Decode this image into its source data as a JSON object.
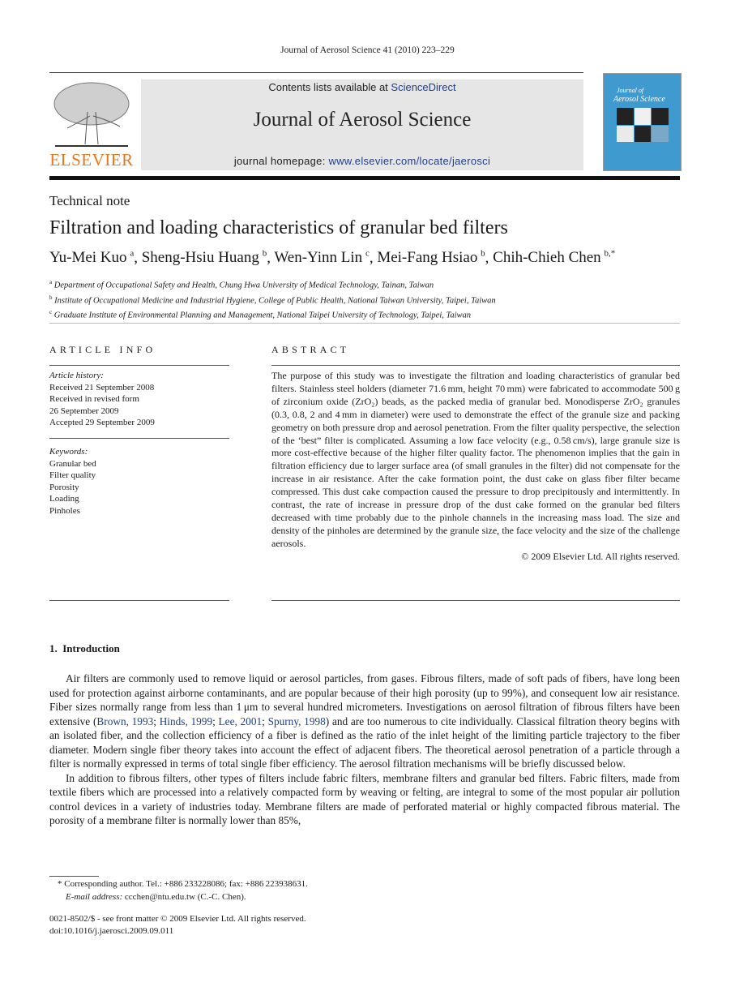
{
  "running_head": "Journal of Aerosol Science 41 (2010) 223–229",
  "publisher_logo": {
    "word": "ELSEVIER",
    "color": "#e8771a"
  },
  "banner": {
    "contents_prefix": "Contents lists available at ",
    "contents_link": "ScienceDirect",
    "journal_title": "Journal of Aerosol Science",
    "homepage_prefix": "journal homepage: ",
    "homepage_link": "www.elsevier.com/locate/jaerosci",
    "background": "#e6e6e6",
    "link_color": "#1f3e8c"
  },
  "cover": {
    "line1": "Journal of",
    "line2": "Aerosol Science",
    "color": "#3f9ad0"
  },
  "article_type": "Technical note",
  "title": "Filtration and loading characteristics of granular bed filters",
  "authors": [
    {
      "name": "Yu-Mei Kuo",
      "sup": "a",
      "sep": ", "
    },
    {
      "name": "Sheng-Hsiu Huang",
      "sup": "b",
      "sep": ", "
    },
    {
      "name": "Wen-Yinn Lin",
      "sup": "c",
      "sep": ", "
    },
    {
      "name": "Mei-Fang Hsiao",
      "sup": "b",
      "sep": ", "
    },
    {
      "name": "Chih-Chieh Chen",
      "sup": "b,*",
      "sep": ""
    }
  ],
  "affiliations": [
    {
      "sup": "a",
      "text": "Department of Occupational Safety and Health, Chung Hwa University of Medical Technology, Tainan, Taiwan"
    },
    {
      "sup": "b",
      "text": "Institute of Occupational Medicine and Industrial Hygiene, College of Public Health, National Taiwan University, Taipei, Taiwan"
    },
    {
      "sup": "c",
      "text": "Graduate Institute of Environmental Planning and Management, National Taipei University of Technology, Taipei, Taiwan"
    }
  ],
  "article_info": {
    "heading": "ARTICLE INFO",
    "history_label": "Article history:",
    "history": [
      "Received 21 September 2008",
      "Received in revised form",
      "26 September 2009",
      "Accepted 29 September 2009"
    ],
    "keywords_label": "Keywords:",
    "keywords": [
      "Granular bed",
      "Filter quality",
      "Porosity",
      "Loading",
      "Pinholes"
    ]
  },
  "abstract": {
    "heading": "ABSTRACT",
    "text": "The purpose of this study was to investigate the filtration and loading characteristics of granular bed filters. Stainless steel holders (diameter 71.6 mm, height 70 mm) were fabricated to accommodate 500 g of zirconium oxide (ZrO₂) beads, as the packed media of granular bed. Monodisperse ZrO₂ granules (0.3, 0.8, 2 and 4 mm in diameter) were used to demonstrate the effect of the granule size and packing geometry on both pressure drop and aerosol penetration. From the filter quality perspective, the selection of the ‘best” filter is complicated. Assuming a low face velocity (e.g., 0.58 cm/s), large granule size is more cost-effective because of the higher filter quality factor. The phenomenon implies that the gain in filtration efficiency due to larger surface area (of small granules in the filter) did not compensate for the increase in air resistance. After the cake formation point, the dust cake on glass fiber filter became compressed. This dust cake compaction caused the pressure to drop precipitously and intermittently. In contrast, the rate of increase in pressure drop of the dust cake formed on the granular bed filters decreased with time probably due to the pinhole channels in the increasing mass load. The size and density of the pinholes are determined by the granule size, the face velocity and the size of the challenge aerosols.",
    "copyright": "© 2009 Elsevier Ltd. All rights reserved."
  },
  "intro": {
    "heading": "1. Introduction",
    "p1_a": "Air filters are commonly used to remove liquid or aerosol particles, from gases. Fibrous filters, made of soft pads of fibers, have long been used for protection against airborne contaminants, and are popular because of their high porosity (up to 99%), and consequent low air resistance. Fiber sizes normally range from less than 1 μm to several hundred micrometers. Investigations on aerosol filtration of fibrous filters have been extensive (",
    "cite1": "Brown, 1993",
    "cite2": "Hinds, 1999",
    "cite3": "Lee, 2001",
    "cite4": "Spurny, 1998",
    "p1_b": ") and are too numerous to cite individually. Classical filtration theory begins with an isolated fiber, and the collection efficiency of a fiber is defined as the ratio of the inlet height of the limiting particle trajectory to the fiber diameter. Modern single fiber theory takes into account the effect of adjacent fibers. The theoretical aerosol penetration of a particle through a filter is normally expressed in terms of total single fiber efficiency. The aerosol filtration mechanisms will be briefly discussed below.",
    "p2": "In addition to fibrous filters, other types of filters include fabric filters, membrane filters and granular bed filters. Fabric filters, made from textile fibers which are processed into a relatively compacted form by weaving or felting, are integral to some of the most popular air pollution control devices in a variety of industries today. Membrane filters are made of perforated material or highly compacted fibrous material. The porosity of a membrane filter is normally lower than 85%,"
  },
  "footnote": {
    "corresponding": "* Corresponding author. Tel.: +886 233228086; fax: +886 223938631.",
    "email_label": "E-mail address:",
    "email": " ccchen@ntu.edu.tw (C.-C. Chen)."
  },
  "issn_line": "0021-8502/$ - see front matter © 2009 Elsevier Ltd. All rights reserved.",
  "doi": "doi:10.1016/j.jaerosci.2009.09.011"
}
